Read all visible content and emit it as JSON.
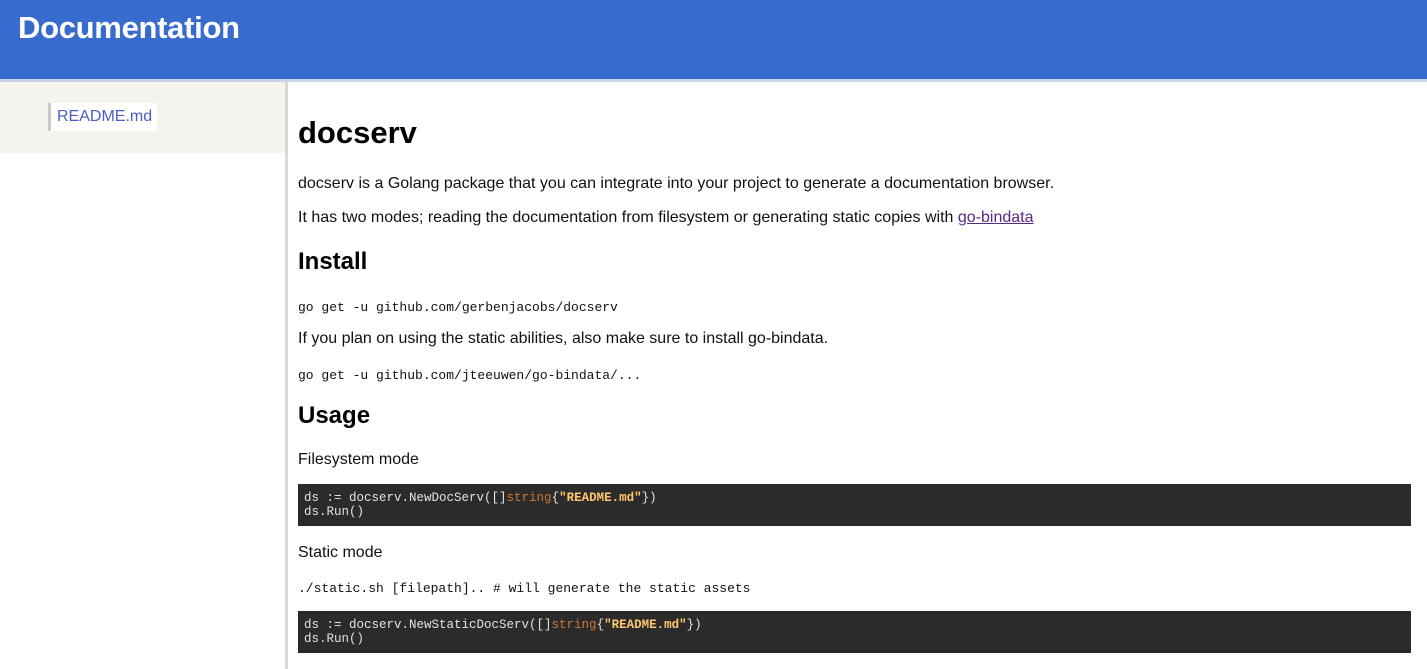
{
  "header": {
    "title": "Documentation"
  },
  "sidebar": {
    "items": [
      {
        "label": "README.md"
      }
    ]
  },
  "main": {
    "title": "docserv",
    "intro": "docserv is a Golang package that you can integrate into your project to generate a documentation browser.",
    "modes_text": "It has two modes; reading the documentation from filesystem or generating static copies with ",
    "modes_link": "go-bindata",
    "install_heading": "Install",
    "install_cmd": "go get -u github.com/gerbenjacobs/docserv",
    "static_note": "If you plan on using the static abilities, also make sure to install go-bindata.",
    "bindata_cmd": "go get -u github.com/jteeuwen/go-bindata/...",
    "usage_heading": "Usage",
    "fs_mode_label": "Filesystem mode",
    "code1": {
      "line1_prefix": "ds := docserv.NewDocServ([]",
      "line1_kw": "string",
      "line1_brace_open": "{",
      "line1_str": "\"README.md\"",
      "line1_suffix": "})",
      "line2": "ds.Run()"
    },
    "static_mode_label": "Static mode",
    "static_cmd": "./static.sh [filepath].. # will generate the static assets",
    "code2": {
      "line1_prefix": "ds := docserv.NewStaticDocServ([]",
      "line1_kw": "string",
      "line1_brace_open": "{",
      "line1_str": "\"README.md\"",
      "line1_suffix": "})",
      "line2": "ds.Run()"
    }
  },
  "colors": {
    "header_bg": "#386bce",
    "sidebar_panel_bg": "#f5f3ed",
    "nav_link": "#4a5fc1",
    "visited_link": "#5a2a82",
    "code_bg": "#2b2b2b",
    "code_keyword": "#cc7833",
    "code_string": "#ffc66d"
  }
}
